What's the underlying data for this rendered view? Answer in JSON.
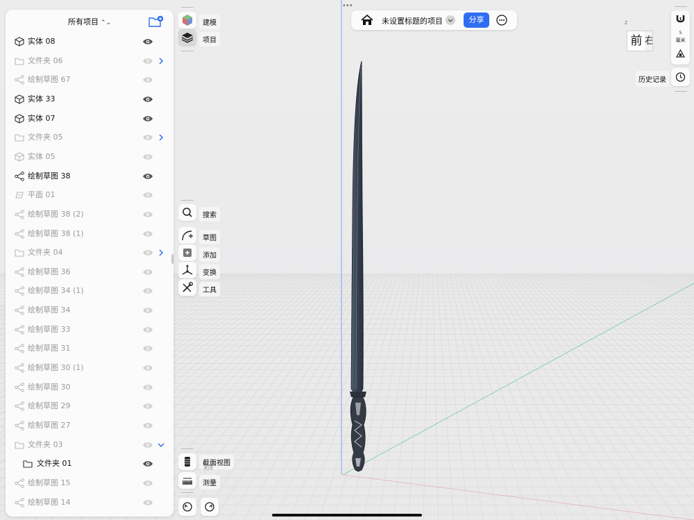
{
  "panel": {
    "title": "所有项目",
    "items": [
      {
        "label": "实体  08",
        "icon": "cube-icon",
        "visible": true,
        "expand": ""
      },
      {
        "label": "文件夹 06",
        "icon": "folder-icon",
        "visible": false,
        "expand": "right"
      },
      {
        "label": "绘制草图 67",
        "icon": "sketch-icon",
        "visible": false,
        "expand": ""
      },
      {
        "label": "实体  33",
        "icon": "cube-icon",
        "visible": true,
        "expand": ""
      },
      {
        "label": "实体  07",
        "icon": "cube-icon",
        "visible": true,
        "expand": ""
      },
      {
        "label": "文件夹 05",
        "icon": "folder-icon",
        "visible": false,
        "expand": "right"
      },
      {
        "label": "实体  05",
        "icon": "cube-icon",
        "visible": false,
        "expand": ""
      },
      {
        "label": "绘制草图 38",
        "icon": "sketch-icon",
        "visible": true,
        "expand": ""
      },
      {
        "label": "平面  01",
        "icon": "plane-icon",
        "visible": false,
        "expand": ""
      },
      {
        "label": "绘制草图 38 (2)",
        "icon": "sketch-icon",
        "visible": false,
        "expand": ""
      },
      {
        "label": "绘制草图 38 (1)",
        "icon": "sketch-icon",
        "visible": false,
        "expand": ""
      },
      {
        "label": "文件夹 04",
        "icon": "folder-icon",
        "visible": false,
        "expand": "right"
      },
      {
        "label": "绘制草图 36",
        "icon": "sketch-icon",
        "visible": false,
        "expand": ""
      },
      {
        "label": "绘制草图 34 (1)",
        "icon": "sketch-icon",
        "visible": false,
        "expand": ""
      },
      {
        "label": "绘制草图 34",
        "icon": "sketch-icon",
        "visible": false,
        "expand": ""
      },
      {
        "label": "绘制草图 33",
        "icon": "sketch-icon",
        "visible": false,
        "expand": ""
      },
      {
        "label": "绘制草图 31",
        "icon": "sketch-icon",
        "visible": false,
        "expand": ""
      },
      {
        "label": "绘制草图 30 (1)",
        "icon": "sketch-icon",
        "visible": false,
        "expand": ""
      },
      {
        "label": "绘制草图 30",
        "icon": "sketch-icon",
        "visible": false,
        "expand": ""
      },
      {
        "label": "绘制草图 29",
        "icon": "sketch-icon",
        "visible": false,
        "expand": ""
      },
      {
        "label": "绘制草图 27",
        "icon": "sketch-icon",
        "visible": false,
        "expand": ""
      },
      {
        "label": "文件夹 03",
        "icon": "folder-icon",
        "visible": false,
        "expand": "down"
      },
      {
        "label": "文件夹 01",
        "icon": "folder-icon",
        "visible": true,
        "expand": "",
        "indent": true
      },
      {
        "label": "绘制草图 15",
        "icon": "sketch-icon",
        "visible": false,
        "expand": ""
      },
      {
        "label": "绘制草图 14",
        "icon": "sketch-icon",
        "visible": false,
        "expand": ""
      }
    ]
  },
  "tools": {
    "modeling": "建模",
    "project": "项目",
    "search": "搜索",
    "sketch": "草图",
    "add": "添加",
    "transform": "变换",
    "tools": "工具",
    "section_view": "截面视图",
    "section_view_state": "关闭",
    "measure": "测量"
  },
  "topbar": {
    "title": "未设置标题的项目",
    "share": "分享"
  },
  "right": {
    "unit_value": "5",
    "unit": "毫米",
    "history": "历史记录"
  },
  "viewcube": {
    "front": "前",
    "right": "右",
    "axis": "Z"
  },
  "colors": {
    "accent": "#2f6ef2",
    "blade": "#3b4454",
    "background": "#eeeeef"
  }
}
